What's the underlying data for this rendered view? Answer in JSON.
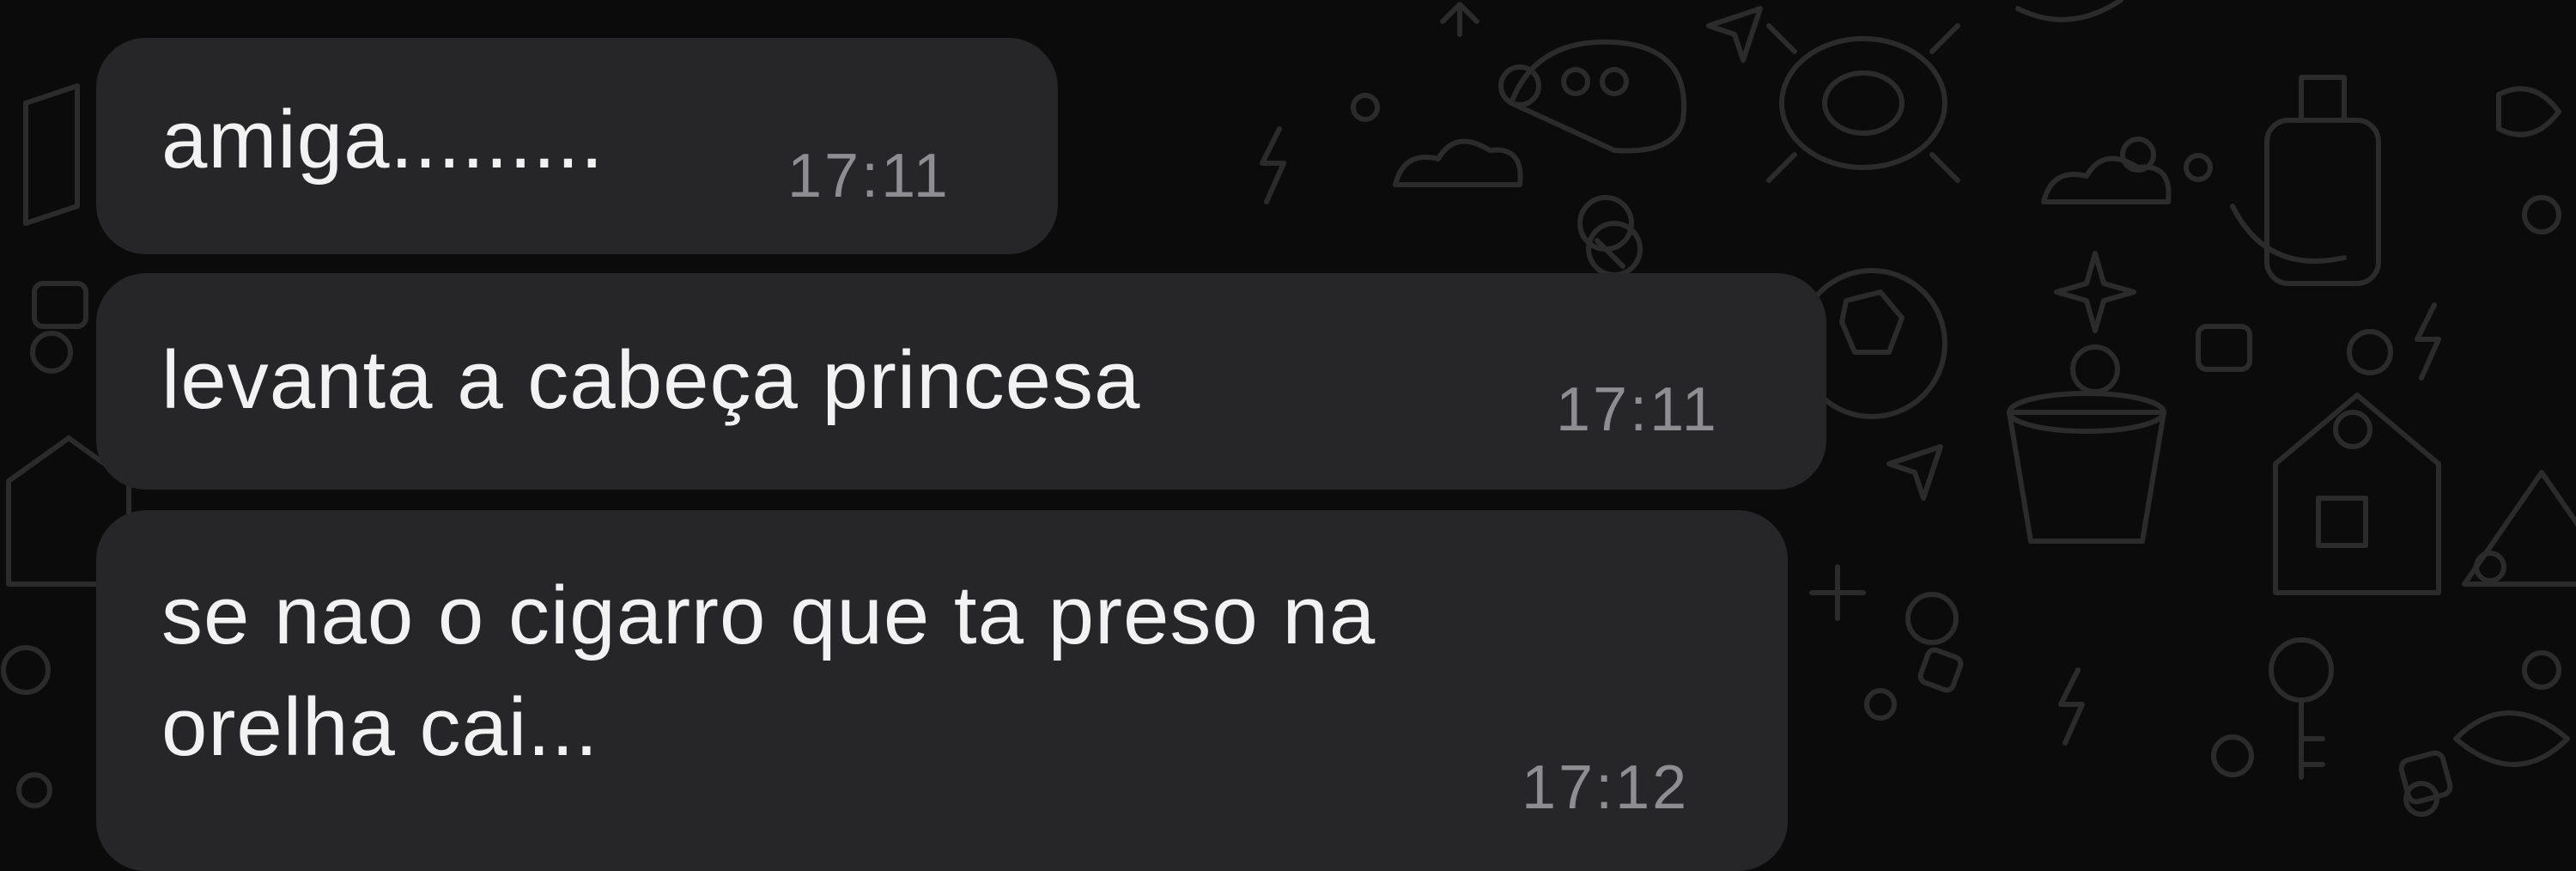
{
  "chat": {
    "messages": [
      {
        "text": "amiga.........",
        "time": "17:11"
      },
      {
        "text": "levanta a cabeça princesa",
        "time": "17:11"
      },
      {
        "text": "se nao o cigarro que ta preso na\norelha cai...",
        "time": "17:12"
      }
    ]
  },
  "colors": {
    "background": "#0b0b0b",
    "bubble": "#262628",
    "text": "#f2f2f2",
    "timestamp": "#8e8e92"
  }
}
